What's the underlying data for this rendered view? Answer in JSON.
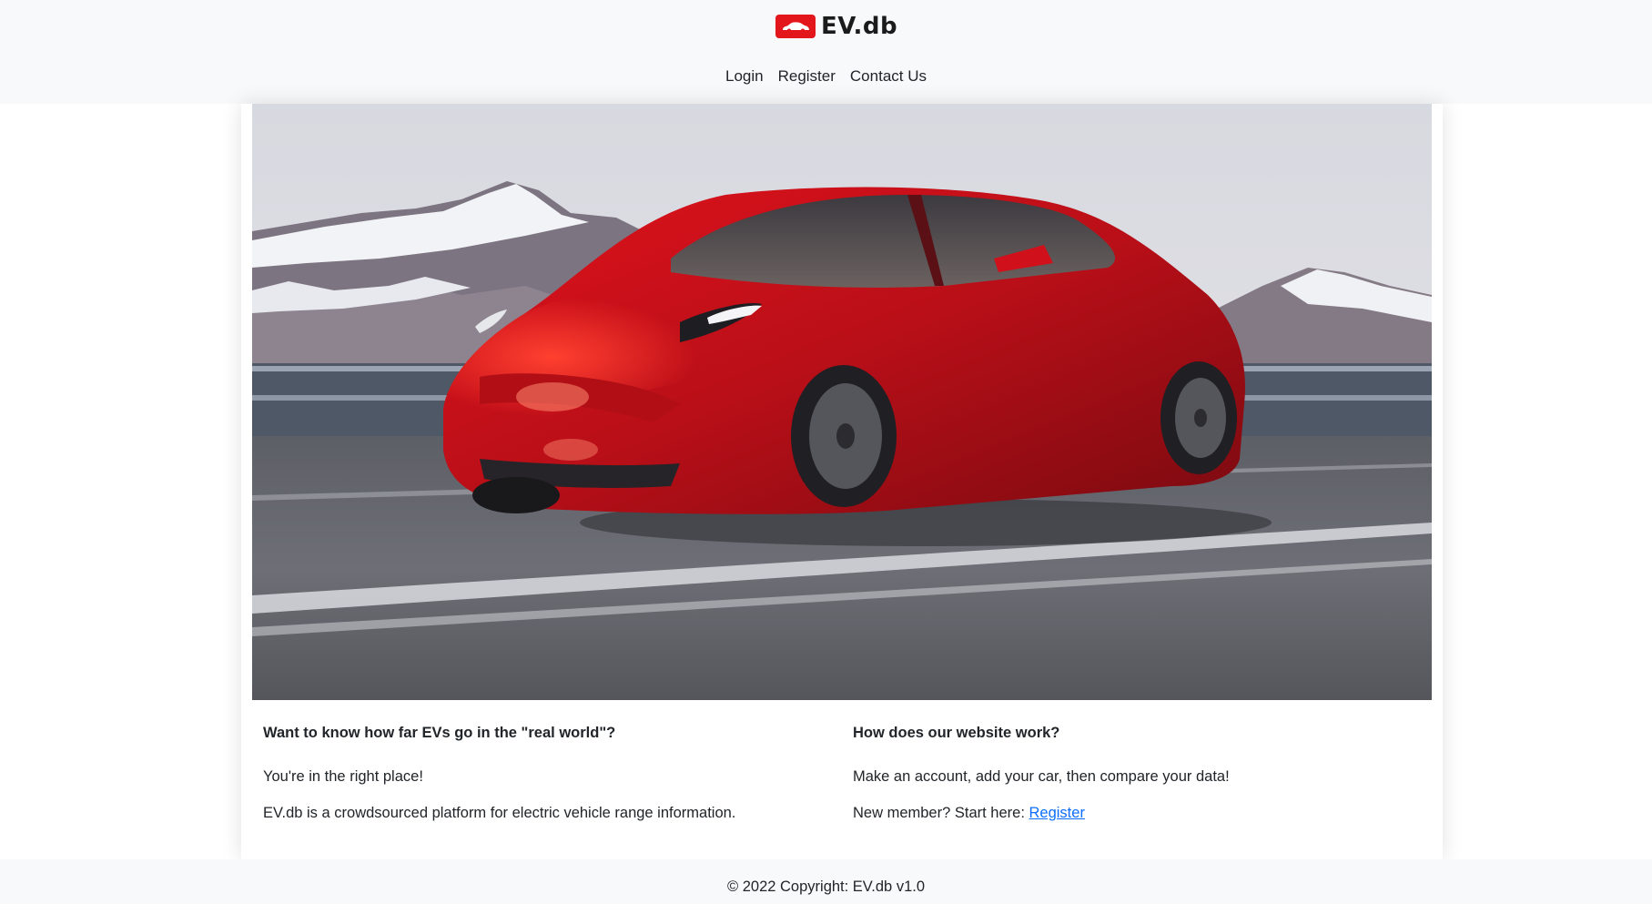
{
  "brand": {
    "name": "EV.db",
    "logo_icon": "car-icon",
    "logo_color": "#e3161c"
  },
  "nav": {
    "items": [
      {
        "label": "Login"
      },
      {
        "label": "Register"
      },
      {
        "label": "Contact Us"
      }
    ]
  },
  "hero": {
    "image": "red-electric-car-on-mountain-road"
  },
  "left_section": {
    "heading": "Want to know how far EVs go in the \"real world\"?",
    "line1": "You're in the right place!",
    "line2": "EV.db is a crowdsourced platform for electric vehicle range information."
  },
  "right_section": {
    "heading": "How does our website work?",
    "line1": "Make an account, add your car, then compare your data!",
    "line2_prefix": "New member? Start here: ",
    "register_link": "Register"
  },
  "footer": {
    "text": "© 2022 Copyright: EV.db v1.0"
  },
  "colors": {
    "link": "#0d6efd",
    "header_bg": "#f8f9fa"
  }
}
